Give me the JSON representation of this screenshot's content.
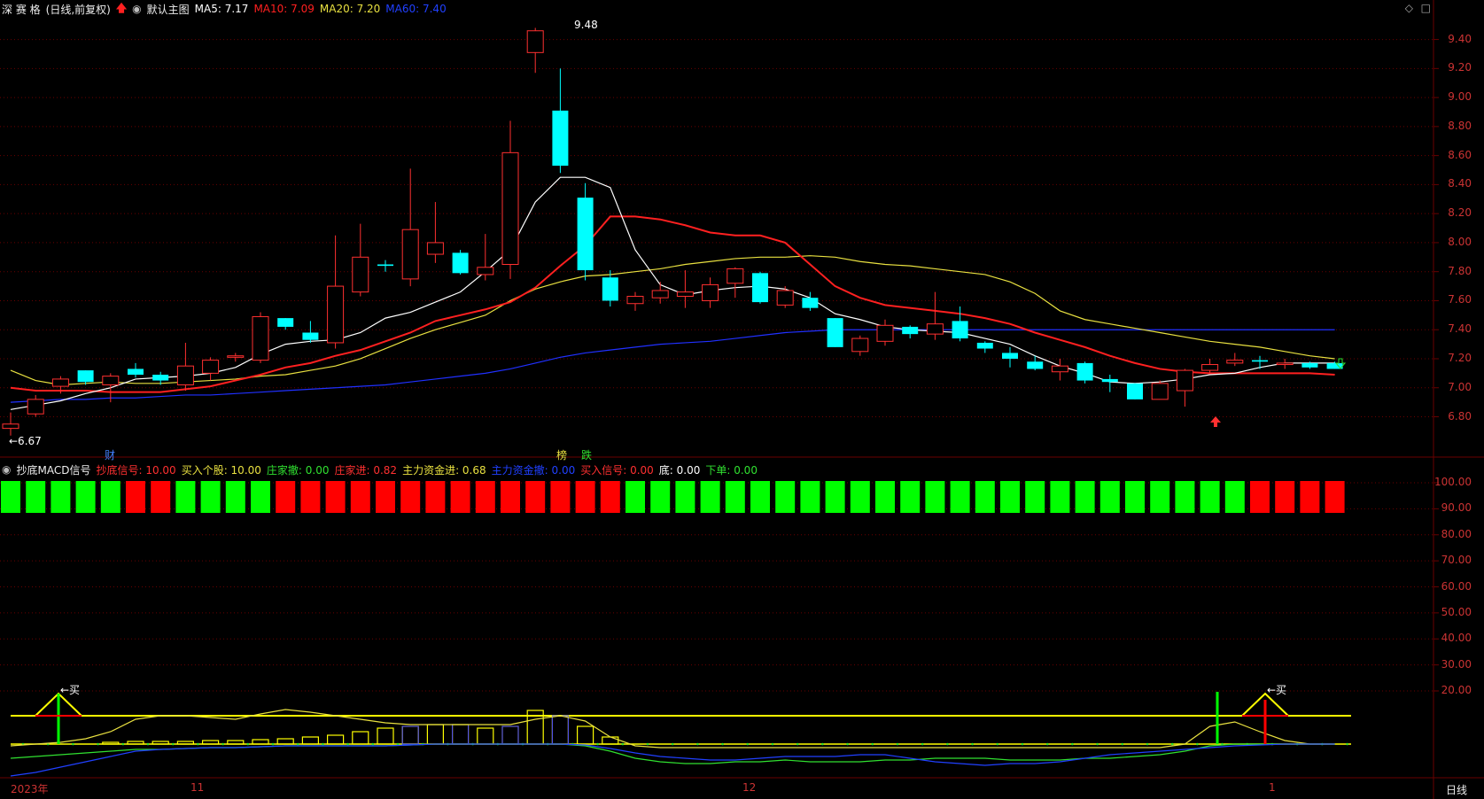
{
  "header": {
    "stock_name": "深 赛 格",
    "period": "(日线,前复权)",
    "layout_name": "默认主图",
    "ma5": "MA5: 7.17",
    "ma10": "MA10: 7.09",
    "ma20": "MA20: 7.20",
    "ma60": "MA60: 7.40"
  },
  "colors": {
    "bg": "#000000",
    "grid": "#6a0000",
    "up": "#ff3030",
    "down": "#00ffff",
    "ma5": "#ffffff",
    "ma10": "#ff2020",
    "ma20": "#e8e040",
    "ma60": "#2030ff"
  },
  "annotations": {
    "high_label": "9.48",
    "low_label": "←6.67",
    "cai": "财",
    "bang": "榜",
    "die": "跌",
    "buy_left": "←买",
    "buy_right": "←买"
  },
  "price_axis": [
    "9.40",
    "9.20",
    "9.00",
    "8.80",
    "8.60",
    "8.40",
    "8.20",
    "8.00",
    "7.80",
    "7.60",
    "7.40",
    "7.20",
    "7.00",
    "6.80"
  ],
  "indicator": {
    "name": "抄底MACD信号",
    "items": [
      {
        "text": "抄底信号: 10.00",
        "color": "#ff3030"
      },
      {
        "text": "买入个股: 10.00",
        "color": "#e8e040"
      },
      {
        "text": "庄家撤: 0.00",
        "color": "#30e030"
      },
      {
        "text": "庄家进: 0.82",
        "color": "#ff3030"
      },
      {
        "text": "主力资金进: 0.68",
        "color": "#e8e040"
      },
      {
        "text": "主力资金撤: 0.00",
        "color": "#2040ff"
      },
      {
        "text": "买入信号: 0.00",
        "color": "#ff3030"
      },
      {
        "text": "底: 0.00",
        "color": "#ffffff"
      },
      {
        "text": "下单: 0.00",
        "color": "#30e030"
      }
    ],
    "axis": [
      "100.00",
      "90.00",
      "80.00",
      "70.00",
      "60.00",
      "50.00",
      "40.00",
      "30.00",
      "20.00"
    ]
  },
  "date_axis": {
    "labels": [
      "2023年",
      "11",
      "12",
      "1"
    ],
    "period_button": "日线"
  },
  "chart_data": {
    "type": "candlestick",
    "ylim": [
      6.62,
      9.55
    ],
    "candles": [
      {
        "o": 6.72,
        "h": 6.83,
        "l": 6.67,
        "c": 6.75
      },
      {
        "o": 6.82,
        "h": 6.95,
        "l": 6.8,
        "c": 6.92
      },
      {
        "o": 7.01,
        "h": 7.08,
        "l": 6.96,
        "c": 7.06
      },
      {
        "o": 7.12,
        "h": 7.12,
        "l": 7.02,
        "c": 7.04
      },
      {
        "o": 7.02,
        "h": 7.1,
        "l": 6.9,
        "c": 7.08
      },
      {
        "o": 7.13,
        "h": 7.17,
        "l": 7.07,
        "c": 7.09
      },
      {
        "o": 7.09,
        "h": 7.11,
        "l": 7.02,
        "c": 7.05
      },
      {
        "o": 7.02,
        "h": 7.31,
        "l": 6.98,
        "c": 7.15
      },
      {
        "o": 7.1,
        "h": 7.21,
        "l": 7.05,
        "c": 7.19
      },
      {
        "o": 7.21,
        "h": 7.24,
        "l": 7.18,
        "c": 7.22
      },
      {
        "o": 7.19,
        "h": 7.52,
        "l": 7.17,
        "c": 7.49
      },
      {
        "o": 7.48,
        "h": 7.48,
        "l": 7.4,
        "c": 7.42
      },
      {
        "o": 7.38,
        "h": 7.46,
        "l": 7.31,
        "c": 7.33
      },
      {
        "o": 7.31,
        "h": 8.05,
        "l": 7.27,
        "c": 7.7
      },
      {
        "o": 7.66,
        "h": 8.13,
        "l": 7.63,
        "c": 7.9
      },
      {
        "o": 7.85,
        "h": 7.88,
        "l": 7.8,
        "c": 7.84
      },
      {
        "o": 7.75,
        "h": 8.51,
        "l": 7.7,
        "c": 8.09
      },
      {
        "o": 7.92,
        "h": 8.28,
        "l": 7.86,
        "c": 8.0
      },
      {
        "o": 7.93,
        "h": 7.95,
        "l": 7.78,
        "c": 7.79
      },
      {
        "o": 7.78,
        "h": 8.06,
        "l": 7.74,
        "c": 7.83
      },
      {
        "o": 7.85,
        "h": 8.84,
        "l": 7.75,
        "c": 8.62
      },
      {
        "o": 9.31,
        "h": 9.48,
        "l": 9.17,
        "c": 9.46
      },
      {
        "o": 8.91,
        "h": 9.2,
        "l": 8.48,
        "c": 8.53
      },
      {
        "o": 8.31,
        "h": 8.41,
        "l": 7.74,
        "c": 7.81
      },
      {
        "o": 7.76,
        "h": 7.81,
        "l": 7.56,
        "c": 7.6
      },
      {
        "o": 7.58,
        "h": 7.66,
        "l": 7.53,
        "c": 7.63
      },
      {
        "o": 7.62,
        "h": 7.73,
        "l": 7.58,
        "c": 7.67
      },
      {
        "o": 7.63,
        "h": 7.81,
        "l": 7.55,
        "c": 7.66
      },
      {
        "o": 7.6,
        "h": 7.76,
        "l": 7.55,
        "c": 7.71
      },
      {
        "o": 7.72,
        "h": 7.83,
        "l": 7.62,
        "c": 7.82
      },
      {
        "o": 7.79,
        "h": 7.8,
        "l": 7.58,
        "c": 7.59
      },
      {
        "o": 7.57,
        "h": 7.7,
        "l": 7.55,
        "c": 7.67
      },
      {
        "o": 7.62,
        "h": 7.66,
        "l": 7.53,
        "c": 7.55
      },
      {
        "o": 7.48,
        "h": 7.48,
        "l": 7.28,
        "c": 7.28
      },
      {
        "o": 7.25,
        "h": 7.36,
        "l": 7.22,
        "c": 7.34
      },
      {
        "o": 7.32,
        "h": 7.47,
        "l": 7.29,
        "c": 7.43
      },
      {
        "o": 7.42,
        "h": 7.43,
        "l": 7.34,
        "c": 7.37
      },
      {
        "o": 7.37,
        "h": 7.66,
        "l": 7.33,
        "c": 7.44
      },
      {
        "o": 7.46,
        "h": 7.56,
        "l": 7.32,
        "c": 7.34
      },
      {
        "o": 7.31,
        "h": 7.32,
        "l": 7.24,
        "c": 7.27
      },
      {
        "o": 7.24,
        "h": 7.28,
        "l": 7.14,
        "c": 7.2
      },
      {
        "o": 7.18,
        "h": 7.22,
        "l": 7.12,
        "c": 7.13
      },
      {
        "o": 7.11,
        "h": 7.2,
        "l": 7.05,
        "c": 7.15
      },
      {
        "o": 7.17,
        "h": 7.18,
        "l": 7.03,
        "c": 7.05
      },
      {
        "o": 7.06,
        "h": 7.09,
        "l": 6.97,
        "c": 7.04
      },
      {
        "o": 7.03,
        "h": 7.03,
        "l": 6.92,
        "c": 6.92
      },
      {
        "o": 6.92,
        "h": 7.05,
        "l": 6.92,
        "c": 7.03
      },
      {
        "o": 6.98,
        "h": 7.13,
        "l": 6.87,
        "c": 7.12
      },
      {
        "o": 7.12,
        "h": 7.2,
        "l": 7.1,
        "c": 7.16
      },
      {
        "o": 7.17,
        "h": 7.24,
        "l": 7.15,
        "c": 7.19
      },
      {
        "o": 7.19,
        "h": 7.22,
        "l": 7.13,
        "c": 7.18
      },
      {
        "o": 7.16,
        "h": 7.2,
        "l": 7.13,
        "c": 7.17
      },
      {
        "o": 7.17,
        "h": 7.18,
        "l": 7.13,
        "c": 7.14
      },
      {
        "o": 7.17,
        "h": 7.18,
        "l": 7.13,
        "c": 7.13
      }
    ],
    "ma5": [
      6.85,
      6.88,
      6.91,
      6.96,
      7.0,
      7.06,
      7.07,
      7.08,
      7.1,
      7.14,
      7.23,
      7.3,
      7.32,
      7.33,
      7.38,
      7.48,
      7.52,
      7.59,
      7.66,
      7.8,
      7.95,
      8.28,
      8.45,
      8.45,
      8.38,
      7.95,
      7.71,
      7.64,
      7.67,
      7.69,
      7.7,
      7.68,
      7.62,
      7.51,
      7.47,
      7.42,
      7.4,
      7.39,
      7.38,
      7.34,
      7.3,
      7.22,
      7.15,
      7.1,
      7.04,
      7.03,
      7.04,
      7.06,
      7.09,
      7.1,
      7.14,
      7.17,
      7.17,
      7.17
    ],
    "ma10": [
      7.0,
      6.98,
      6.98,
      6.98,
      6.97,
      6.97,
      6.97,
      6.99,
      7.01,
      7.05,
      7.09,
      7.14,
      7.17,
      7.22,
      7.26,
      7.32,
      7.38,
      7.46,
      7.5,
      7.54,
      7.59,
      7.69,
      7.84,
      7.98,
      8.18,
      8.18,
      8.16,
      8.12,
      8.07,
      8.05,
      8.05,
      8.0,
      7.85,
      7.7,
      7.62,
      7.57,
      7.55,
      7.53,
      7.51,
      7.48,
      7.44,
      7.38,
      7.33,
      7.28,
      7.22,
      7.17,
      7.13,
      7.11,
      7.1,
      7.1,
      7.1,
      7.1,
      7.1,
      7.09
    ],
    "ma20": [
      7.12,
      7.05,
      7.02,
      7.03,
      7.04,
      7.03,
      7.03,
      7.04,
      7.05,
      7.06,
      7.08,
      7.09,
      7.12,
      7.15,
      7.2,
      7.27,
      7.34,
      7.4,
      7.45,
      7.5,
      7.6,
      7.68,
      7.73,
      7.77,
      7.78,
      7.8,
      7.82,
      7.85,
      7.87,
      7.89,
      7.9,
      7.9,
      7.91,
      7.9,
      7.87,
      7.85,
      7.84,
      7.82,
      7.8,
      7.78,
      7.73,
      7.65,
      7.53,
      7.47,
      7.44,
      7.41,
      7.38,
      7.35,
      7.32,
      7.3,
      7.28,
      7.25,
      7.22,
      7.2
    ],
    "ma60": [
      6.9,
      6.91,
      6.92,
      6.92,
      6.93,
      6.93,
      6.94,
      6.95,
      6.95,
      6.96,
      6.97,
      6.98,
      6.99,
      7.0,
      7.01,
      7.02,
      7.04,
      7.06,
      7.08,
      7.1,
      7.13,
      7.17,
      7.21,
      7.24,
      7.26,
      7.28,
      7.3,
      7.31,
      7.32,
      7.34,
      7.36,
      7.38,
      7.39,
      7.4,
      7.4,
      7.4,
      7.4,
      7.4,
      7.4,
      7.4,
      7.4,
      7.4,
      7.4,
      7.4,
      7.4,
      7.4,
      7.4,
      7.4,
      7.4,
      7.4,
      7.4,
      7.4,
      7.4,
      7.4
    ],
    "signal_blocks": [
      "g",
      "g",
      "g",
      "g",
      "g",
      "r",
      "r",
      "g",
      "g",
      "g",
      "g",
      "r",
      "r",
      "r",
      "r",
      "r",
      "r",
      "r",
      "r",
      "r",
      "r",
      "r",
      "r",
      "r",
      "r",
      "g",
      "g",
      "g",
      "g",
      "g",
      "g",
      "g",
      "g",
      "g",
      "g",
      "g",
      "g",
      "g",
      "g",
      "g",
      "g",
      "g",
      "g",
      "g",
      "g",
      "g",
      "g",
      "g",
      "g",
      "g",
      "r",
      "r",
      "r",
      "r"
    ]
  }
}
